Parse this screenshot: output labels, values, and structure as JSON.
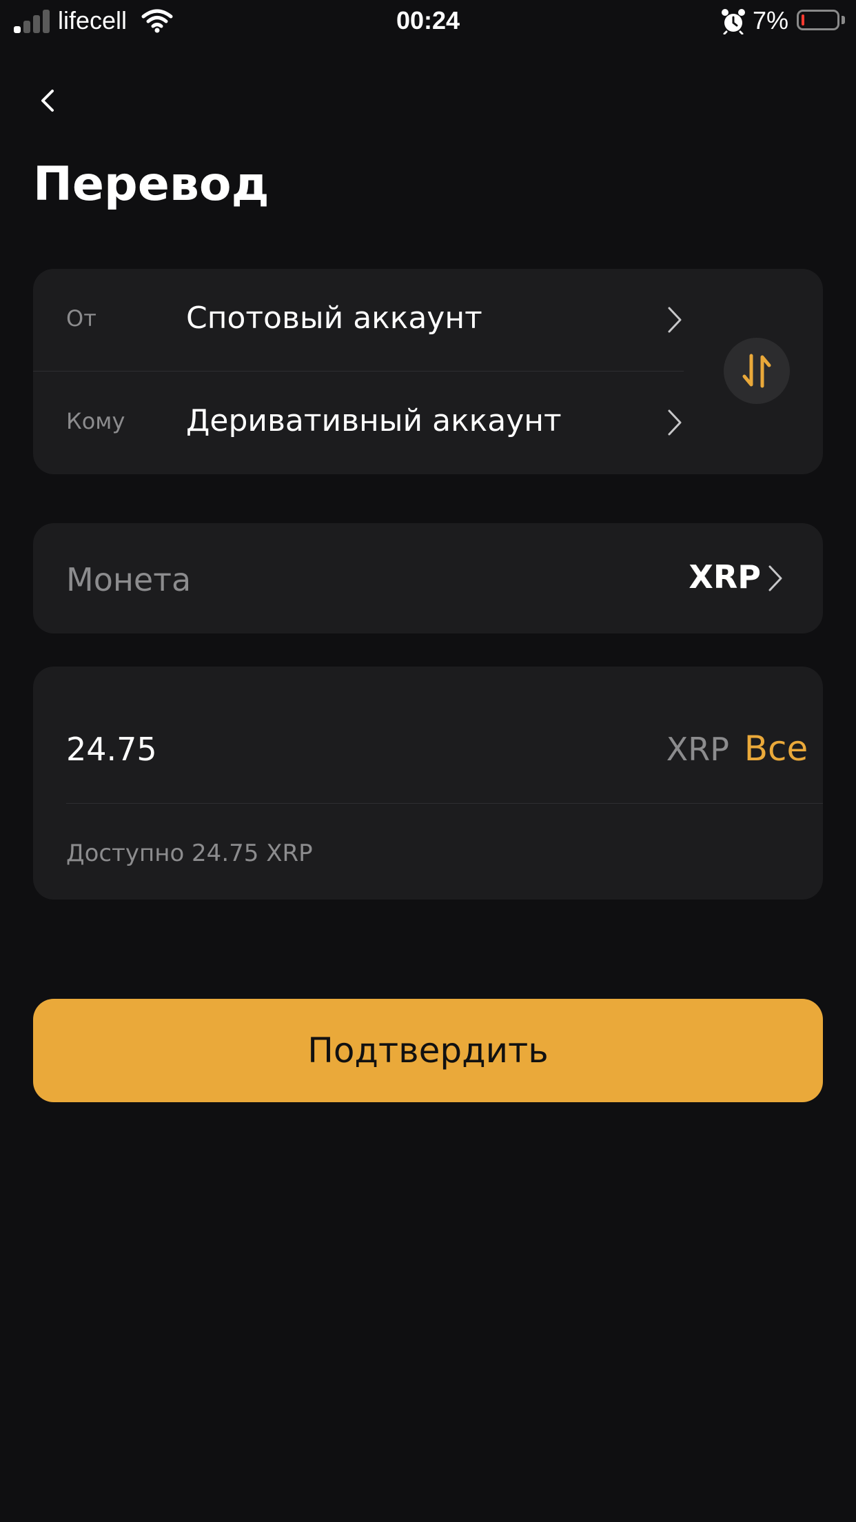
{
  "status_bar": {
    "carrier": "lifecell",
    "time": "00:24",
    "battery_percent": "7%",
    "signal_bars_active": 1,
    "signal_bars_total": 4,
    "battery_level": 0.07,
    "battery_color": "#ff3b30"
  },
  "header": {
    "back_icon": "chevron-left-icon",
    "title": "Перевод"
  },
  "transfer": {
    "from_label": "От",
    "from_value": "Спотовый аккаунт",
    "to_label": "Кому",
    "to_value": "Деривативный аккаунт",
    "swap_icon": "swap-arrows-icon"
  },
  "coin": {
    "label": "Монета",
    "value": "XRP"
  },
  "amount": {
    "value": "24.75",
    "unit": "XRP",
    "all_label": "Все",
    "available_text": "Доступно 24.75 XRP"
  },
  "confirm_label": "Подтвердить",
  "colors": {
    "accent": "#eaa93a",
    "background": "#0f0f11",
    "card": "#1c1c1e",
    "muted_text": "#8c8c8e"
  }
}
